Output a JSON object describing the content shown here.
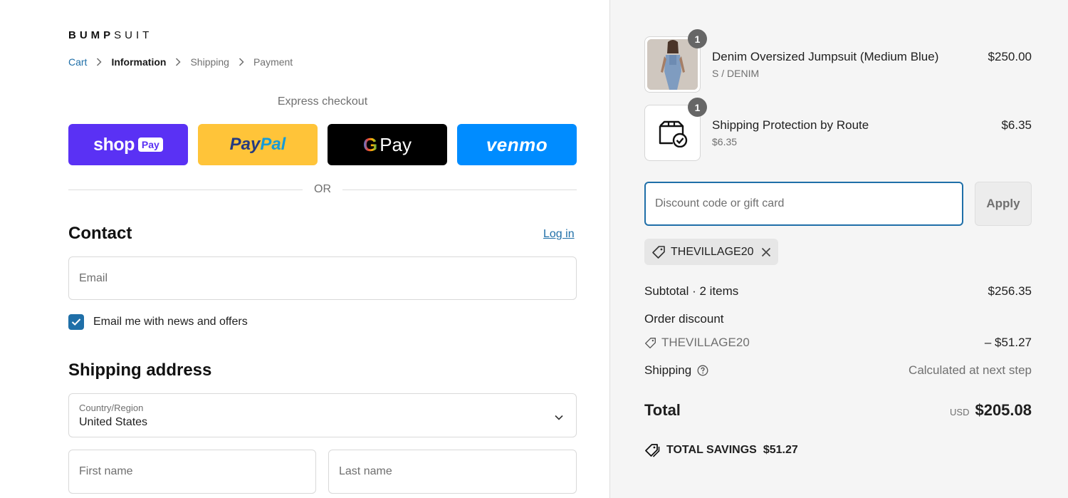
{
  "brand": {
    "bold": "BUMP",
    "light": "SUIT"
  },
  "breadcrumb": {
    "cart": "Cart",
    "information": "Information",
    "shipping": "Shipping",
    "payment": "Payment"
  },
  "express": {
    "title": "Express checkout",
    "shop_word": "shop",
    "shop_chip": "Pay",
    "paypal_1": "Pay",
    "paypal_2": "Pal",
    "gpay_g": "G",
    "gpay_word": "Pay",
    "venmo": "venmo",
    "or": "OR"
  },
  "contact": {
    "heading": "Contact",
    "login": "Log in",
    "email_placeholder": "Email",
    "newsletter_label": "Email me with news and offers",
    "newsletter_checked": true
  },
  "shipping_address": {
    "heading": "Shipping address",
    "country_label": "Country/Region",
    "country_value": "United States",
    "first_name_placeholder": "First name",
    "last_name_placeholder": "Last name"
  },
  "cart_items": [
    {
      "name": "Denim Oversized Jumpsuit (Medium Blue)",
      "variant": "S / DENIM",
      "price": "$250.00",
      "quantity": "1",
      "icon": "product-photo"
    },
    {
      "name": "Shipping Protection by Route",
      "variant": "$6.35",
      "price": "$6.35",
      "quantity": "1",
      "icon": "shipping-protection-icon"
    }
  ],
  "discount": {
    "placeholder": "Discount code or gift card",
    "apply": "Apply",
    "applied_code": "THEVILLAGE20"
  },
  "summary": {
    "subtotal_label": "Subtotal · 2 items",
    "subtotal_value": "$256.35",
    "order_discount_label": "Order discount",
    "discount_code": "THEVILLAGE20",
    "discount_value": "– $51.27",
    "shipping_label": "Shipping",
    "shipping_value": "Calculated at next step",
    "total_label": "Total",
    "currency": "USD",
    "total_value": "$205.08",
    "savings_label": "TOTAL SAVINGS",
    "savings_value": "$51.27"
  },
  "colors": {
    "link": "#1f6fa8",
    "shop_pay": "#5a31f4",
    "paypal": "#ffc439",
    "gpay": "#000000",
    "venmo": "#008cff",
    "sidebar_bg": "#f5f5f5"
  }
}
